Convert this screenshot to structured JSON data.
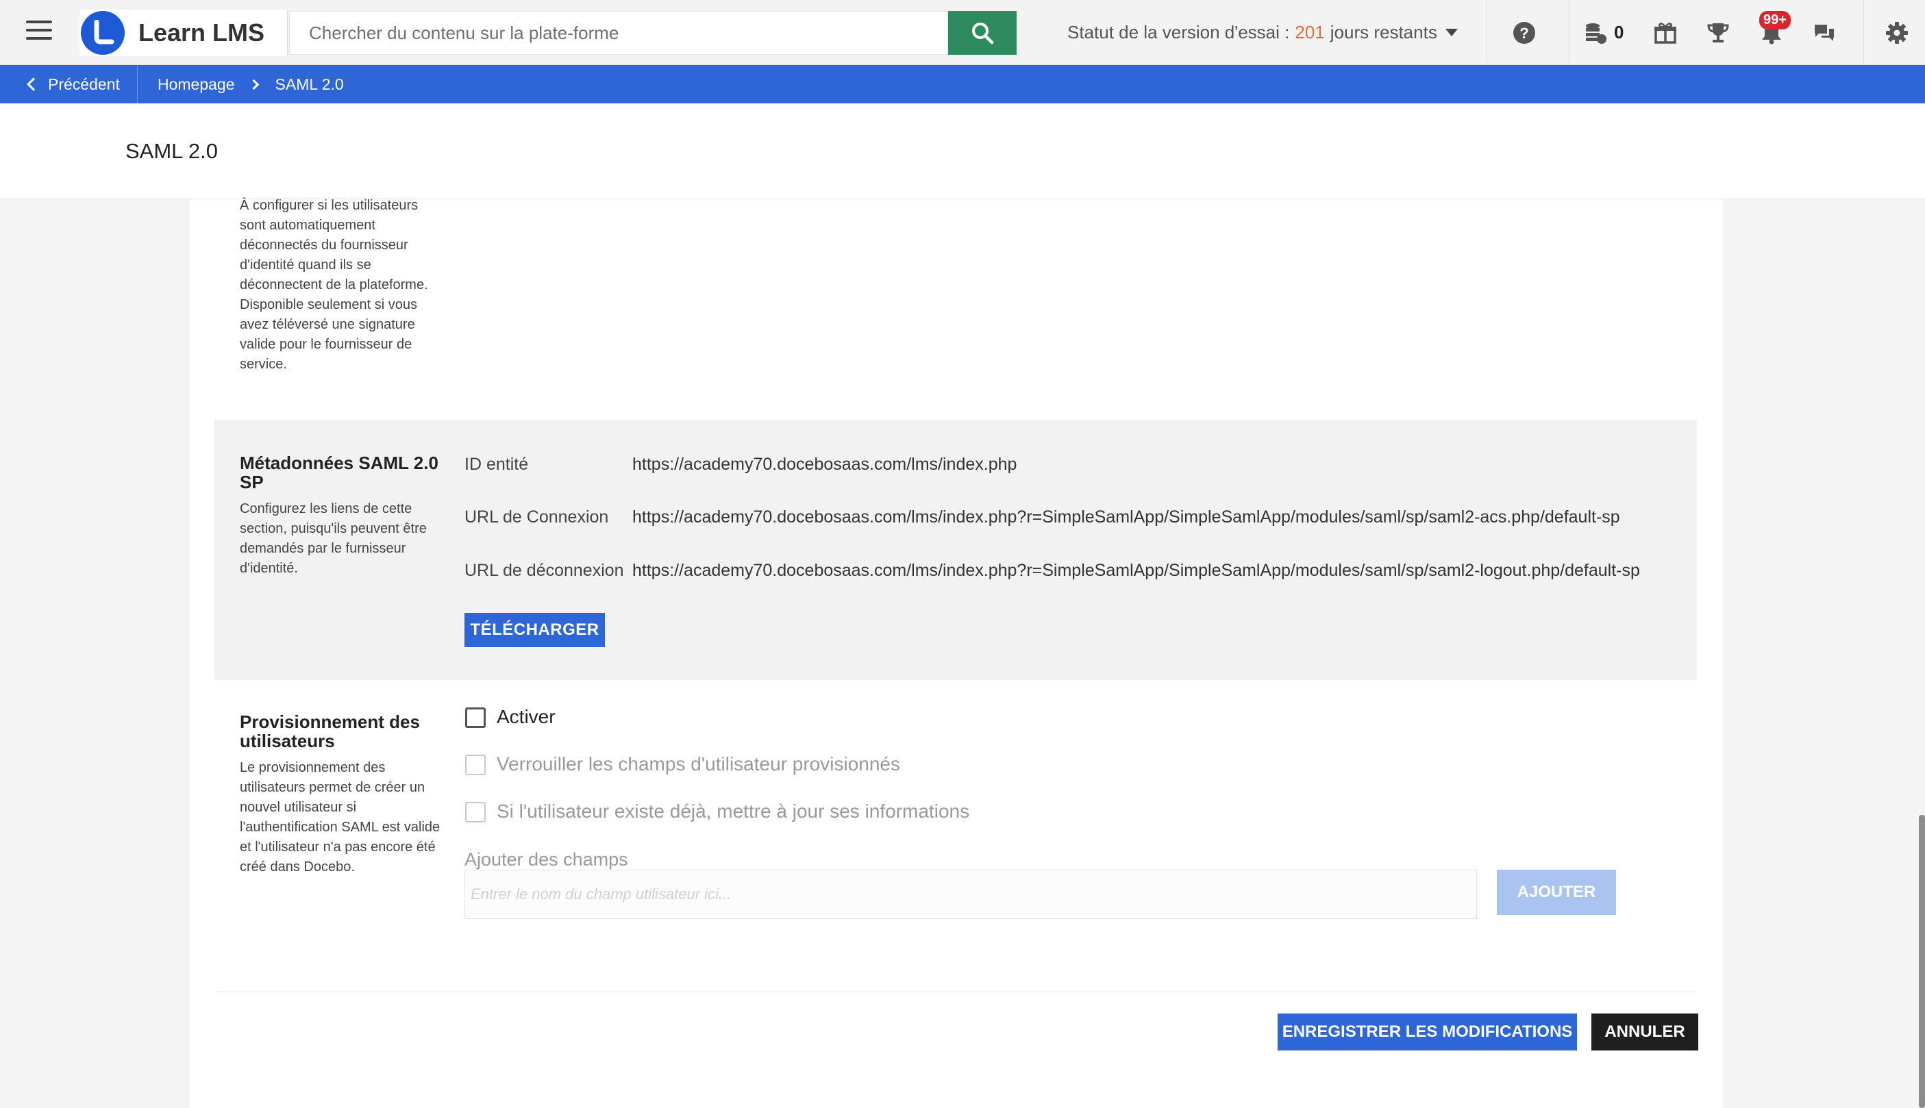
{
  "header": {
    "app_title": "Learn LMS",
    "search_placeholder": "Chercher du contenu sur la plate-forme",
    "trial_label": "Statut de la version d'essai :",
    "trial_days": "201",
    "trial_suffix": "jours restants",
    "credits_count": "0",
    "notifications_badge": "99+",
    "icons": [
      "menu-icon",
      "search-icon",
      "help-icon",
      "coins-icon",
      "gift-icon",
      "trophy-icon",
      "bell-icon",
      "chat-icon",
      "gear-icon"
    ]
  },
  "breadcrumb": {
    "back_label": "Précédent",
    "items": [
      "Homepage",
      "SAML 2.0"
    ]
  },
  "page": {
    "title": "SAML 2.0"
  },
  "sections": {
    "logout": {
      "description": "À configurer si les utilisateurs sont automatiquement déconnectés du fournisseur d'identité quand ils se déconnectent de la plateforme. Disponible seulement si vous avez téléversé une signature valide pour le fournisseur de service."
    },
    "metadata": {
      "title": "Métadonnées SAML 2.0 SP",
      "description": "Configurez les liens de cette section, puisqu'ils peuvent être demandés par le furnisseur d'identité.",
      "rows": [
        {
          "label": "ID entité",
          "value": "https://academy70.docebosaas.com/lms/index.php"
        },
        {
          "label": "URL de Connexion",
          "value": "https://academy70.docebosaas.com/lms/index.php?r=SimpleSamlApp/SimpleSamlApp/modules/saml/sp/saml2-acs.php/default-sp"
        },
        {
          "label": "URL de déconnexion",
          "value": "https://academy70.docebosaas.com/lms/index.php?r=SimpleSamlApp/SimpleSamlApp/modules/saml/sp/saml2-logout.php/default-sp"
        }
      ],
      "download_label": "TÉLÉCHARGER"
    },
    "provisioning": {
      "title": "Provisionnement des utilisateurs",
      "description": "Le provisionnement des utilisateurs permet de créer un nouvel utilisateur si l'authentification SAML est valide et l'utilisateur n'a pas encore été créé dans Docebo.",
      "options": [
        {
          "label": "Activer",
          "checked": false,
          "disabled": false
        },
        {
          "label": "Verrouiller les champs d'utilisateur provisionnés",
          "checked": false,
          "disabled": true
        },
        {
          "label": "Si l'utilisateur existe déjà, mettre à jour ses informations",
          "checked": false,
          "disabled": true
        }
      ],
      "fields_label": "Ajouter des champs",
      "field_placeholder": "Entrer le nom du champ utilisateur ici...",
      "add_label": "AJOUTER"
    }
  },
  "footer": {
    "save_label": "ENREGISTRER LES MODIFICATIONS",
    "cancel_label": "ANNULER"
  }
}
